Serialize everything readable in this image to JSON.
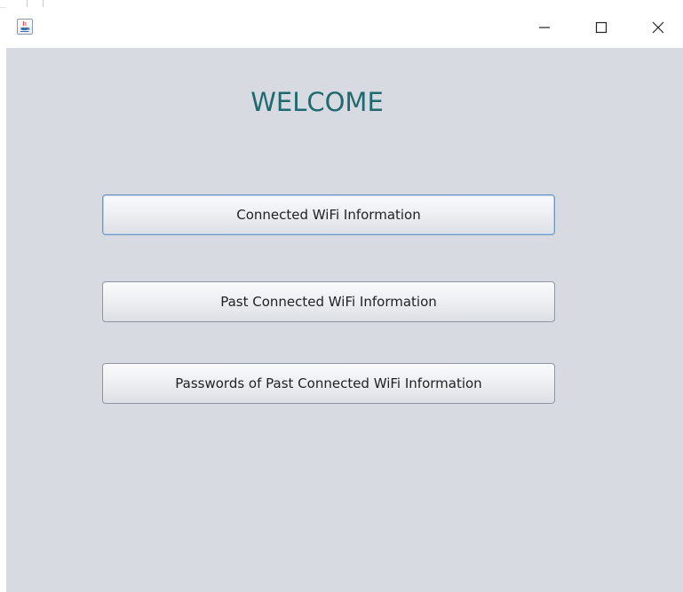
{
  "titlebar": {
    "app_icon": "java-icon",
    "minimize_icon": "minimize-icon",
    "maximize_icon": "maximize-icon",
    "close_icon": "close-icon"
  },
  "main": {
    "heading": "WELCOME",
    "buttons": [
      {
        "label": "Connected WiFi Information",
        "focused": true
      },
      {
        "label": "Past Connected WiFi Information",
        "focused": false
      },
      {
        "label": "Passwords of Past Connected WiFi Information",
        "focused": false
      }
    ]
  },
  "colors": {
    "background": "#d7dae0",
    "heading": "#1f6a70",
    "titlebar": "#ffffff"
  }
}
